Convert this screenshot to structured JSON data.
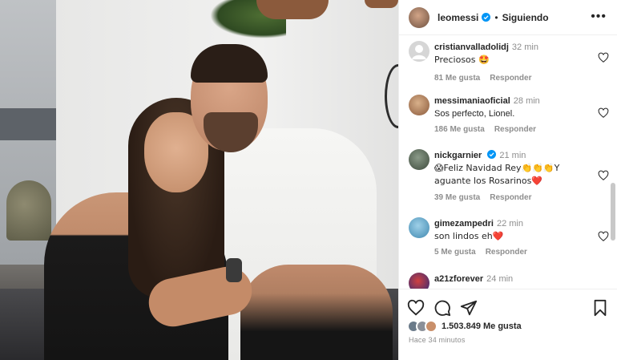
{
  "header": {
    "username": "leomessi",
    "separator": "•",
    "follow_status": "Siguiendo",
    "more_label": "•••"
  },
  "comments": [
    {
      "username": "cristianvalladolidj",
      "time": "32 min",
      "text": "Preciosos 🤩",
      "likes": "81 Me gusta",
      "reply": "Responder",
      "avatar_color": "#d0d0d0"
    },
    {
      "username": "messimaniaoficial",
      "time": "28 min",
      "text": "Sos perfecto, Lionel.",
      "likes": "186 Me gusta",
      "reply": "Responder",
      "avatar_color": "#c9a07a"
    },
    {
      "username": "nickgarnier",
      "time": "21 min",
      "verified": true,
      "text": "😱Feliz Navidad Rey👏👏👏Y aguante los Rosarinos❤️",
      "likes": "39 Me gusta",
      "reply": "Responder",
      "avatar_color": "#4d5a4a"
    },
    {
      "username": "gimezampedri",
      "time": "22 min",
      "text": "son lindos eh❤️",
      "likes": "5 Me gusta",
      "reply": "Responder",
      "avatar_color": "#6fa8c9"
    },
    {
      "username": "a21zforever",
      "time": "24 min",
      "text": "",
      "likes": "",
      "reply": "",
      "avatar_color": "#3a3a8a"
    }
  ],
  "likes": {
    "count_text": "1.503.849 Me gusta"
  },
  "timestamp": "Hace 34 minutos",
  "icons": [
    "heart-icon",
    "comment-icon",
    "share-icon",
    "bookmark-icon",
    "more-icon",
    "verified-icon"
  ],
  "colors": {
    "verified": "#0095f6",
    "text": "#262626",
    "secondary": "#8e8e8e"
  }
}
